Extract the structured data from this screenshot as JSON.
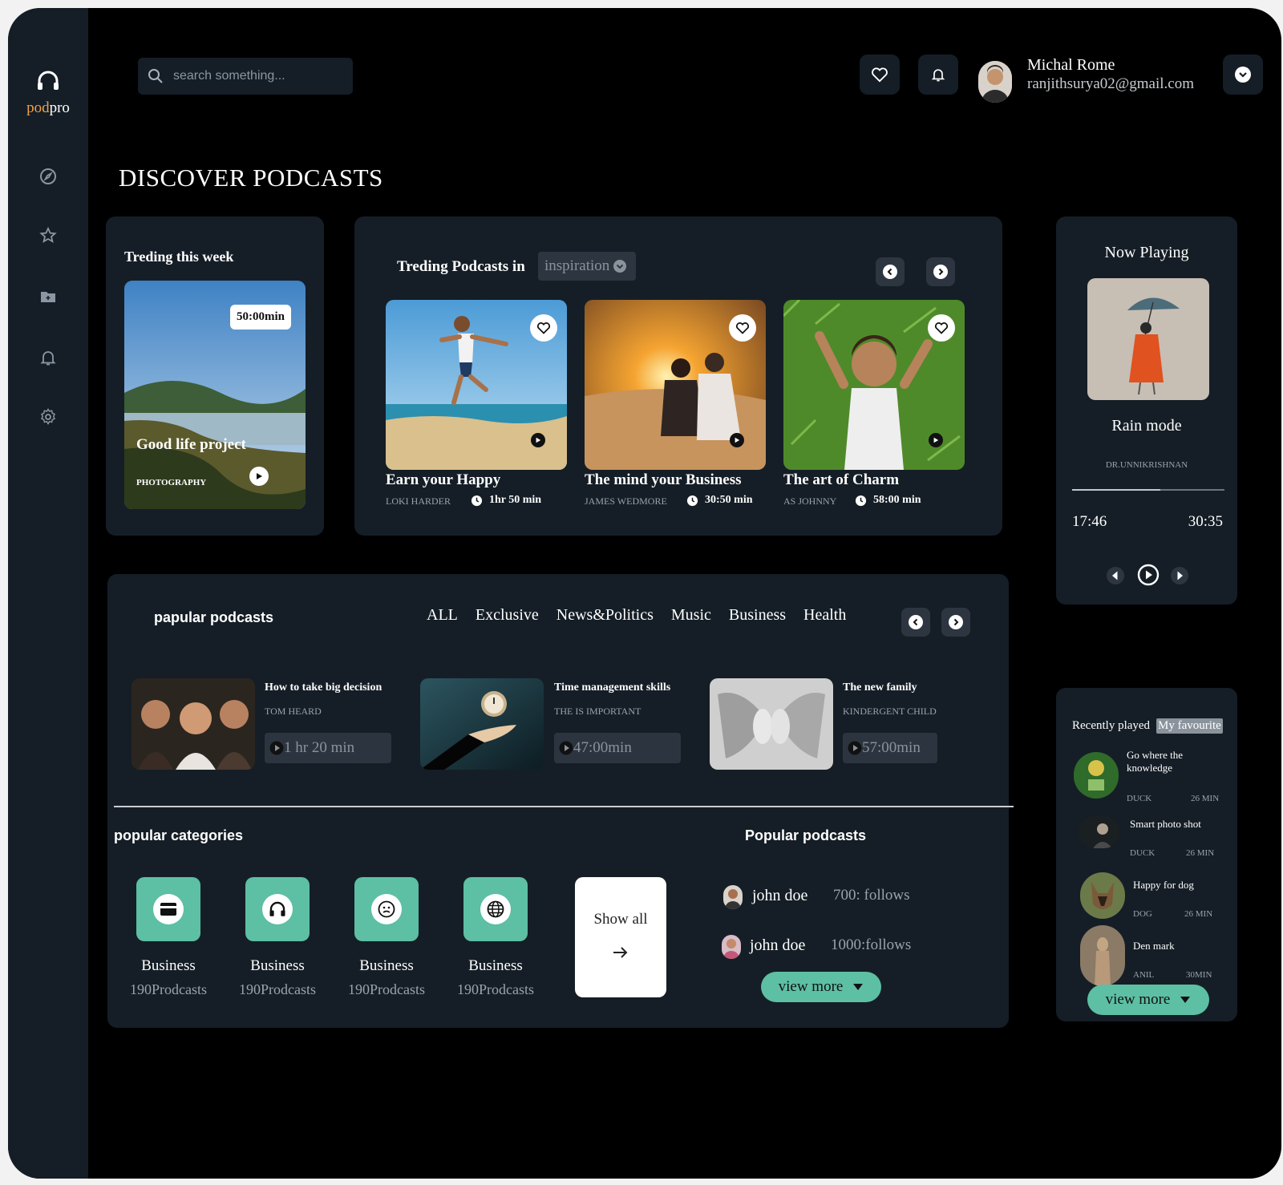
{
  "brand": {
    "pod": "pod",
    "pro": "pro"
  },
  "search": {
    "placeholder": "search something..."
  },
  "user": {
    "name": "Michal Rome",
    "email": "ranjithsurya02@gmail.com"
  },
  "page_title": "DISCOVER PODCASTS",
  "trending_week": {
    "title": "Treding this week",
    "duration": "50:00min",
    "card_title": "Good life project",
    "card_category": "PHOTOGRAPHY"
  },
  "trending_in": {
    "title": "Treding Podcasts in",
    "filter": "inspiration",
    "cards": [
      {
        "title": "Earn your Happy",
        "author": "LOKI HARDER",
        "duration": "1hr 50 min"
      },
      {
        "title": "The mind your Business",
        "author": "JAMES WEDMORE",
        "duration": "30:50 min"
      },
      {
        "title": "The art of Charm",
        "author": "AS JOHNNY",
        "duration": "58:00 min"
      }
    ]
  },
  "now_playing": {
    "title": "Now Playing",
    "track": "Rain mode",
    "artist": "DR.UNNIKRISHNAN",
    "elapsed": "17:46",
    "total": "30:35",
    "progress": 0.58
  },
  "popular_podcasts": {
    "title": "papular podcasts",
    "tabs": [
      "ALL",
      "Exclusive",
      "News&Politics",
      "Music",
      "Business",
      "Health"
    ],
    "items": [
      {
        "title": "How to take big decision",
        "author": "TOM HEARD",
        "duration": "1 hr 20 min"
      },
      {
        "title": "Time management skills",
        "author": "THE IS IMPORTANT",
        "duration": "47:00min"
      },
      {
        "title": "The new family",
        "author": "KINDERGENT CHILD",
        "duration": "57:00min"
      }
    ]
  },
  "categories": {
    "title": "popular categories",
    "items": [
      {
        "label": "Business",
        "count": "190Prodcasts",
        "icon": "card-icon"
      },
      {
        "label": "Business",
        "count": "190Prodcasts",
        "icon": "headphones-icon"
      },
      {
        "label": "Business",
        "count": "190Prodcasts",
        "icon": "smiley-icon"
      },
      {
        "label": "Business",
        "count": "190Prodcasts",
        "icon": "globe-icon"
      }
    ],
    "show_all": "Show all"
  },
  "popular_creators": {
    "title": "Popular podcasts",
    "items": [
      {
        "name": "john doe",
        "followers": "700: follows"
      },
      {
        "name": "john doe",
        "followers": "1000:follows"
      }
    ],
    "view_more": "view more"
  },
  "recent": {
    "tab_recent": "Recently played",
    "tab_fav": "My favourite",
    "items": [
      {
        "title": "Go where the knowledge",
        "author": "DUCK",
        "duration": "26 MIN"
      },
      {
        "title": "Smart photo shot",
        "author": "DUCK",
        "duration": "26 MIN"
      },
      {
        "title": "Happy for dog",
        "author": "DOG",
        "duration": "26 MIN"
      },
      {
        "title": "Den mark",
        "author": "ANIL",
        "duration": "30MIN"
      }
    ],
    "view_more": "view more"
  },
  "colors": {
    "accent": "#5dbfa3",
    "panel": "#151e26",
    "brand_orange": "#f0a24a"
  }
}
